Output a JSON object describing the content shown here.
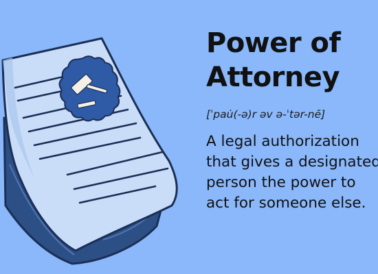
{
  "title": {
    "line1": "Power of",
    "line2": "Attorney"
  },
  "pronunciation": "[ˈpau̇(-ə)r əv ə-ˈtər-nē]",
  "definition": {
    "lines": [
      "A legal authorization",
      "that gives a designated",
      "person the power to",
      "act for someone else."
    ]
  },
  "colors": {
    "background": "#8ab8fb",
    "paper": "#c9dcf8",
    "paper_stack": "#2c4f86",
    "seal": "#2e5aa6",
    "text": "#111111"
  }
}
